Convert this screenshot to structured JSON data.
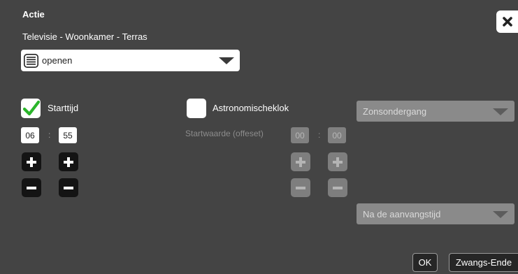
{
  "dialog": {
    "title": "Actie",
    "subtitle": "Televisie - Woonkamer - Terras",
    "close_icon": "close-icon"
  },
  "action_select": {
    "value": "openen",
    "icon": "blinds-icon"
  },
  "start_time": {
    "label": "Starttijd",
    "checked": true,
    "hour": "06",
    "minute": "55",
    "separator": ":"
  },
  "astro": {
    "label": "Astronomischeklok",
    "checked": false,
    "offset_label": "Startwaarde (offeset)",
    "offset_hour": "00",
    "offset_minute": "00",
    "separator": ":",
    "event_select": "Zonsondergang",
    "relation_select": "Na de aanvangstijd"
  },
  "buttons": {
    "ok": "OK",
    "force_end": "Zwangs-Ende"
  },
  "colors": {
    "background": "#444444",
    "button_dark": "#141414",
    "disabled": "#808080",
    "check_green": "#2bb52b"
  }
}
